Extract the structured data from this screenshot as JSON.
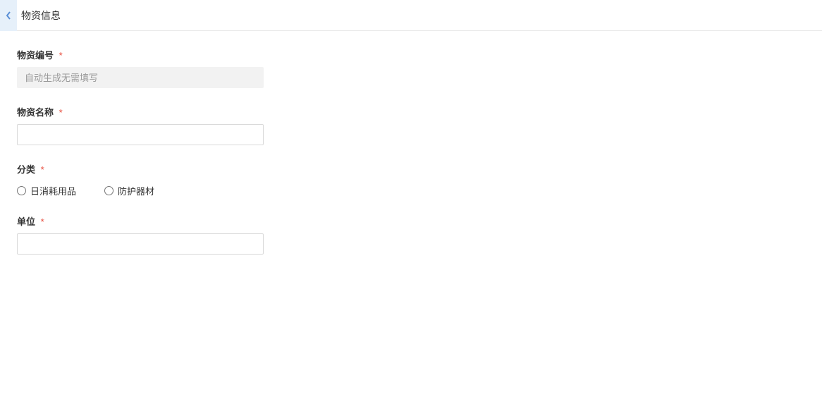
{
  "header": {
    "title": "物资信息"
  },
  "form": {
    "material_number": {
      "label": "物资编号",
      "placeholder": "自动生成无需填写",
      "value": ""
    },
    "material_name": {
      "label": "物资名称",
      "value": ""
    },
    "category": {
      "label": "分类",
      "options": [
        {
          "label": "日消耗用品"
        },
        {
          "label": "防护器材"
        }
      ]
    },
    "unit": {
      "label": "单位",
      "value": ""
    },
    "required_marker": "*"
  }
}
